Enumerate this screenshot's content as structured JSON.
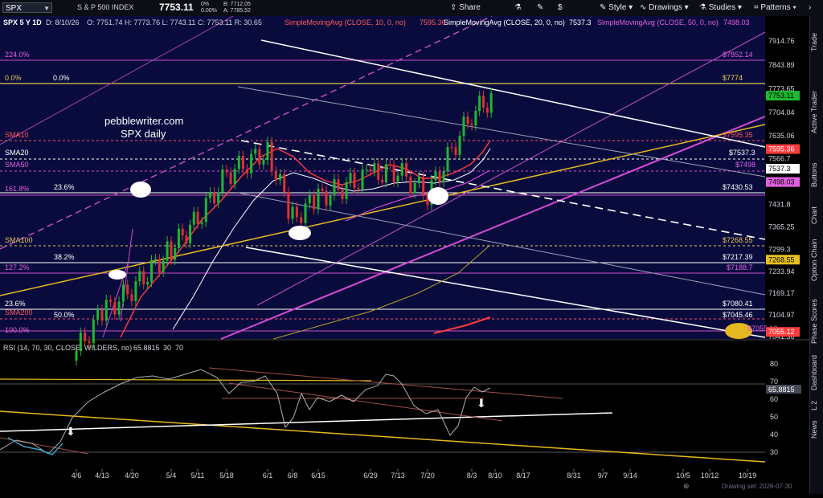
{
  "toolbar": {
    "symbol": "SPX",
    "instrument": "S & P 500 INDEX",
    "last": "7753.11",
    "change_pct": "0%",
    "change": "0.00%",
    "bid": "B: 7712.05",
    "ask": "A: 7785.52",
    "share": "Share",
    "style": "Style",
    "drawings": "Drawings",
    "studies": "Studies",
    "patterns": "Patterns"
  },
  "chart": {
    "header": "SPX 5 Y 1D",
    "date": "D: 8/10/26",
    "ohlc": "O: 7751.74  H: 7773.76  L: 7743.11  C: 7753.11  R: 30.65",
    "sma10": "SimpleMovingAvg (CLOSE, 10, 0, no)",
    "sma10_val": "7595.36",
    "sma20": "SimpleMovingAvg (CLOSE, 20, 0, no)",
    "sma20_val": "7537.3",
    "sma50": "SimpleMovingAvg (CLOSE, 50, 0, no)",
    "sma50_val": "7498.03",
    "watermark_line1": "pebblewriter.com",
    "watermark_line2": "SPX daily",
    "rsi_label": "RSI (14, 70, 30, CLOSE, WILDERS, no)",
    "rsi_val": "65.8815",
    "rsi_30": "30",
    "rsi_70": "70",
    "left_labels": [
      "0.0%",
      "0.0%",
      "224.0%",
      "SMA10",
      "SMA20",
      "SMA50",
      "161.8%",
      "23.6%",
      "SMA100",
      "38.2%",
      "127.2%",
      "23.6%",
      "SMA200",
      "50.0%",
      "100.0%"
    ],
    "right_labels": [
      "$7852.14",
      "$7774",
      "$7595.35",
      "$7537.3",
      "$7498",
      "$7430.53",
      "$7268.55",
      "$7217.39",
      "$7188.7",
      "$7080.41",
      "$7045.46",
      "$7055.12"
    ],
    "yaxis": [
      "7914.76",
      "7843.89",
      "7773.65",
      "7704.04",
      "7635.06",
      "7566.7",
      "7498.03",
      "7431.8",
      "7365.25",
      "7299.3",
      "7233.94",
      "7169.17",
      "7104.97",
      "7041.36"
    ],
    "price_tags": {
      "last": "7753.11",
      "sma10": "7595.36",
      "sma20": "7537.3",
      "sma50": "7498.03",
      "sma100": "7268.55",
      "sma200": "7055.12"
    },
    "rsi_axis": [
      "80",
      "70",
      "60",
      "50",
      "40",
      "30"
    ],
    "rsi_tag": "65.8815",
    "xaxis": [
      "4/6",
      "4/13",
      "4/20",
      "5/4",
      "5/11",
      "5/18",
      "6/1",
      "6/8",
      "6/15",
      "6/29",
      "7/13",
      "7/20",
      "8/3",
      "8/10",
      "8/17",
      "8/31",
      "9/7",
      "9/14",
      "10/5",
      "10/12",
      "10/19"
    ],
    "footer": "Drawing set: 2026-07-30"
  },
  "sidebar": [
    "Trade",
    "Active Trader",
    "Buttons",
    "Chart",
    "Option Chain",
    "Phase Scores",
    "Dashboard",
    "L 2",
    "News"
  ],
  "chart_data": {
    "type": "candlestick",
    "x": [
      "4/6",
      "4/13",
      "4/20",
      "5/4",
      "5/11",
      "5/18",
      "6/1",
      "6/8",
      "6/15",
      "6/29",
      "7/13",
      "7/20",
      "8/3",
      "8/10"
    ],
    "close": [
      7000,
      7110,
      7180,
      7300,
      7390,
      7520,
      7590,
      7390,
      7450,
      7520,
      7530,
      7460,
      7700,
      7753
    ],
    "rsi_last": 65.8815
  },
  "colors": {
    "bg": "#000000",
    "panel": "#0b0e14",
    "sma10": "#ff3b3b",
    "sma20": "#ffffff",
    "sma50": "#d44bd4",
    "sma100": "#ffcc33",
    "sma200": "#ff3b3b",
    "candle_up": "#1db82e",
    "candle_down": "#e03030"
  }
}
